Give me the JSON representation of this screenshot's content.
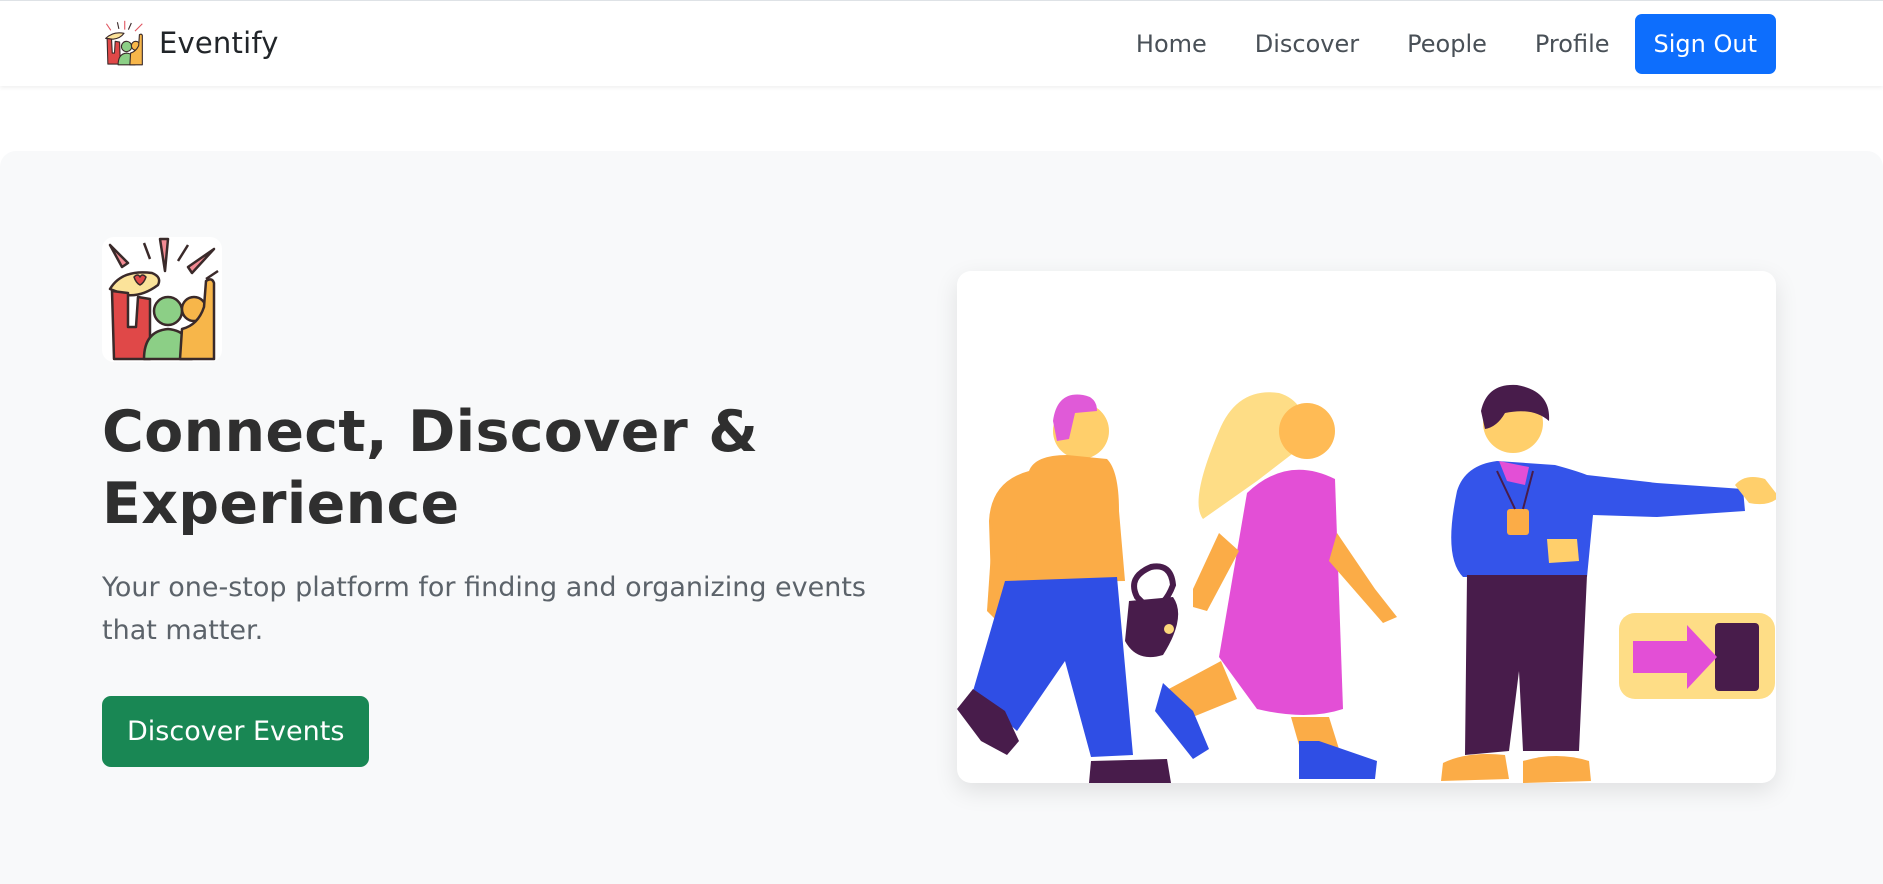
{
  "navbar": {
    "brand_name": "Eventify",
    "brand_icon": "eventify-logo-icon",
    "links": [
      "Home",
      "Discover",
      "People",
      "Profile"
    ],
    "signout_label": "Sign Out",
    "signout_color": "#0d6efd"
  },
  "hero": {
    "logo_icon": "eventify-logo-icon",
    "title": "Connect, Discover & Experience",
    "subtitle": "Your one-stop platform for finding and organizing events that matter.",
    "cta_label": "Discover Events",
    "cta_color": "#198754",
    "illustration": "people-walking-illustration"
  }
}
